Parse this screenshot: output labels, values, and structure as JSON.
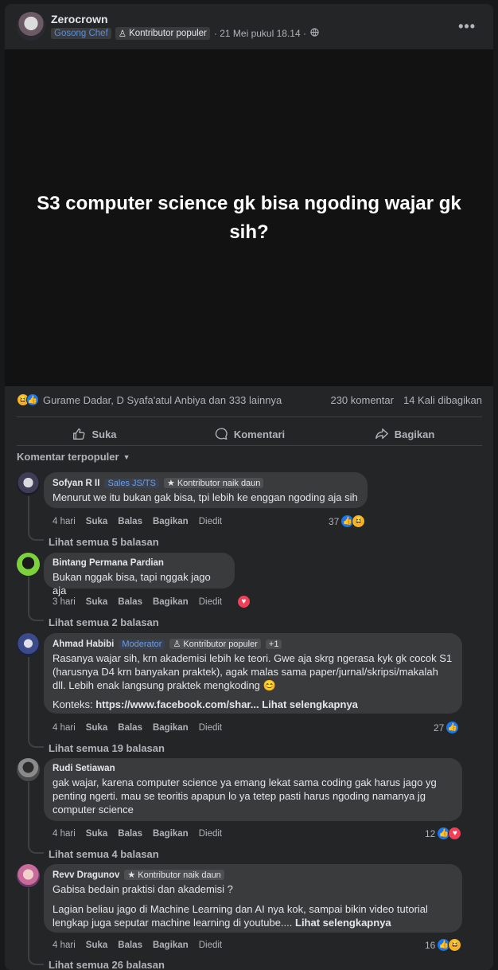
{
  "post": {
    "author": "Zerocrown",
    "group_badge": "Gosong Chef",
    "contributor_badge": "Kontributor populer",
    "timestamp": "· 21 Mei pukul 18.14 ·",
    "more_label": "•••",
    "text": "S3 computer science gk bisa ngoding wajar gk sih?"
  },
  "stats": {
    "reactors": "Gurame Dadar, D Syafa'atul Anbiya dan 333 lainnya",
    "comments": "230 komentar",
    "shares": "14 Kali dibagikan"
  },
  "actions": {
    "like": "Suka",
    "comment": "Komentari",
    "share": "Bagikan"
  },
  "sort_label": "Komentar terpopuler",
  "comment_actions": {
    "like": "Suka",
    "reply": "Balas",
    "share": "Bagikan",
    "edited": "Diedit"
  },
  "comments": [
    {
      "name": "Sofyan R II",
      "badge": "Sales JS/TS",
      "badge2": "Kontributor naik daun",
      "text": "Menurut we itu bukan gak bisa, tpi lebih ke enggan ngoding aja sih",
      "time": "4 hari",
      "react_count": "37",
      "replies": "Lihat semua 5 balasan"
    },
    {
      "name": "Bintang Permana Pardian",
      "text": "Bukan nggak bisa, tapi nggak jago aja",
      "time": "3 hari",
      "react_count": "",
      "replies": "Lihat semua 2 balasan"
    },
    {
      "name": "Ahmad Habibi",
      "badge": "Moderator",
      "badge2": "Kontributor populer",
      "badge3": "+1",
      "text": "Rasanya wajar sih, krn akademisi lebih ke teori. Gwe aja skrg ngerasa kyk gk cocok S1 (harusnya D4 krn banyakan praktek), agak malas sama paper/jurnal/skripsi/makalah dll. Lebih enak langsung praktek mengkoding 😊",
      "context_label": "Konteks:",
      "context_link": "https://www.facebook.com/shar...",
      "see_more": "Lihat selengkapnya",
      "time": "4 hari",
      "react_count": "27",
      "replies": "Lihat semua 19 balasan"
    },
    {
      "name": "Rudi Setiawan",
      "text": "gak wajar, karena computer science ya emang lekat sama coding gak harus jago yg penting ngerti. mau se teoritis apapun lo ya tetep pasti harus ngoding namanya jg computer science",
      "time": "4 hari",
      "react_count": "12",
      "replies": "Lihat semua 4 balasan"
    },
    {
      "name": "Revv Dragunov",
      "badge2": "Kontributor naik daun",
      "text": "Gabisa bedain praktisi dan akademisi ?",
      "text2": "Lagian beliau jago di Machine Learning dan AI nya kok, sampai bikin video tutorial lengkap juga seputar machine learning di youtube....",
      "see_more": "Lihat selengkapnya",
      "time": "4 hari",
      "react_count": "16",
      "replies": "Lihat semua 26 balasan"
    }
  ]
}
